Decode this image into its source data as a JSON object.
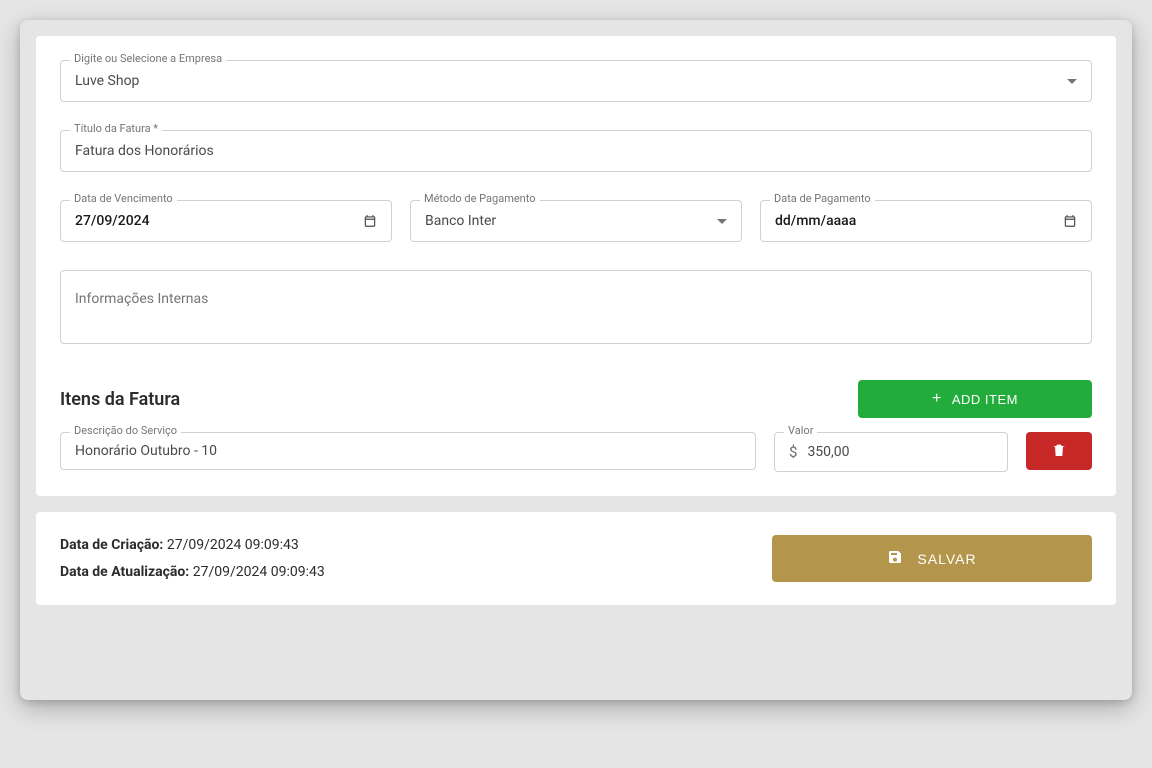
{
  "form": {
    "company_label": "Digite ou Selecione a Empresa",
    "company_value": "Luve Shop",
    "title_label": "Título da Fatura *",
    "title_value": "Fatura dos Honorários",
    "due_date_label": "Data de Vencimento",
    "due_date_value": "27/09/2024",
    "payment_method_label": "Método de Pagamento",
    "payment_method_value": "Banco Inter",
    "payment_date_label": "Data de Pagamento",
    "payment_date_placeholder": "dd/mm/aaaa",
    "internal_info_placeholder": "Informações Internas"
  },
  "items": {
    "section_title": "Itens da Fatura",
    "add_button": "ADD ITEM",
    "desc_label": "Descrição do Serviço",
    "value_label": "Valor",
    "rows": [
      {
        "description": "Honorário Outubro - 10",
        "value": "350,00"
      }
    ]
  },
  "footer": {
    "created_label": "Data de Criação:",
    "created_value": "27/09/2024 09:09:43",
    "updated_label": "Data de Atualização:",
    "updated_value": "27/09/2024 09:09:43",
    "save_button": "SALVAR"
  }
}
